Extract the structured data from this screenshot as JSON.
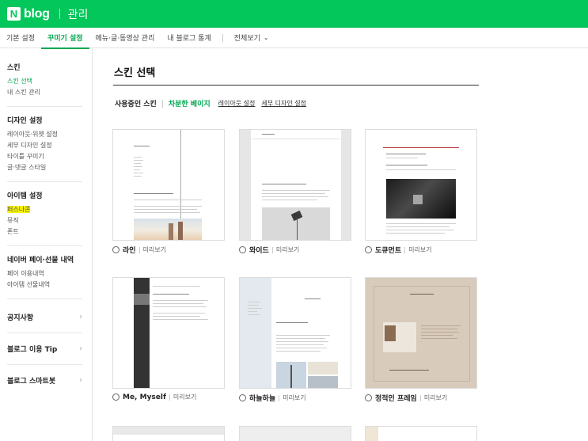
{
  "header": {
    "logo_letter": "N",
    "logo_text": "blog",
    "title": "관리"
  },
  "nav": {
    "items": [
      {
        "label": "기본 설정",
        "active": false
      },
      {
        "label": "꾸미기 설정",
        "active": true
      },
      {
        "label": "메뉴·글·동영상 관리",
        "active": false
      },
      {
        "label": "내 블로그 통계",
        "active": false
      }
    ],
    "view_all": "전체보기"
  },
  "sidebar": {
    "groups": [
      {
        "title": "스킨",
        "items": [
          "스킨 선택",
          "내 스킨 관리"
        ]
      },
      {
        "title": "디자인 설정",
        "items": [
          "레이아웃·위젯 설정",
          "세부 디자인 설정",
          "타이틀 꾸미기",
          "글·댓글 스타일"
        ]
      },
      {
        "title": "아이템 설정",
        "items": [
          "퍼스나콘",
          "뮤직",
          "폰트"
        ]
      },
      {
        "title": "네이버 페이·선물 내역",
        "items": [
          "페이 이용내역",
          "아이템 선물내역"
        ]
      }
    ],
    "links": [
      "공지사항",
      "블로그 이용 Tip",
      "블로그 스마트봇"
    ]
  },
  "main": {
    "title": "스킨 선택",
    "current_label": "사용중인 스킨",
    "current_skin": "차분한 베이지",
    "layout_link": "레이아웃 설정",
    "detail_link": "세부 디자인 설정",
    "preview_label": "미리보기",
    "skins": [
      "라인",
      "와이드",
      "도큐먼트",
      "Me, Myself",
      "하늘하늘",
      "정적인 프레임"
    ]
  },
  "colors": {
    "brand": "#03c75a",
    "accent": "#00a84e",
    "highlight": "#f8f300"
  }
}
